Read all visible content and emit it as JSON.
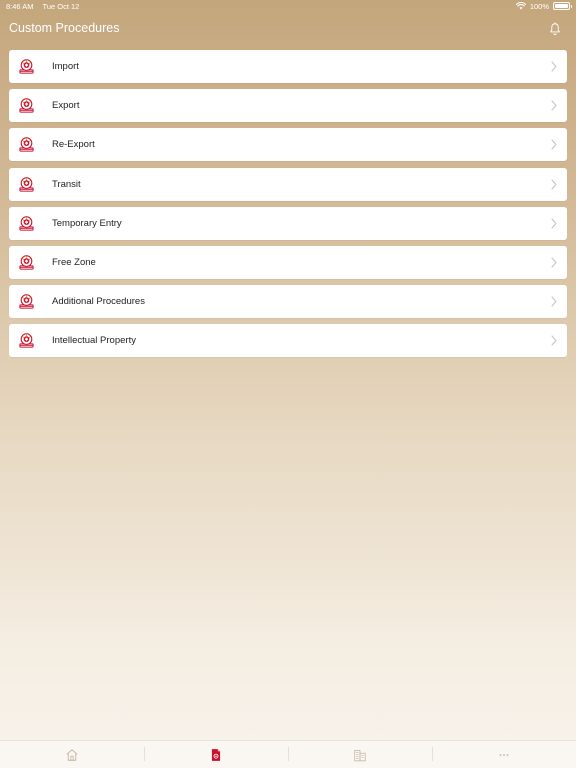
{
  "status_bar": {
    "time": "8:46 AM",
    "date": "Tue Oct 12",
    "battery": "100%"
  },
  "header": {
    "title": "Custom Procedures",
    "action_icon": "bell-icon"
  },
  "procedures": {
    "items": [
      {
        "label": "Import",
        "icon": "customs-logo-icon"
      },
      {
        "label": "Export",
        "icon": "customs-logo-icon"
      },
      {
        "label": "Re-Export",
        "icon": "customs-logo-icon"
      },
      {
        "label": "Transit",
        "icon": "customs-logo-icon"
      },
      {
        "label": "Temporary Entry",
        "icon": "customs-logo-icon"
      },
      {
        "label": "Free Zone",
        "icon": "customs-logo-icon"
      },
      {
        "label": "Additional Procedures",
        "icon": "customs-logo-icon"
      },
      {
        "label": "Intellectual Property",
        "icon": "customs-logo-icon"
      }
    ]
  },
  "tab_bar": {
    "tabs": [
      {
        "icon": "home-icon",
        "active": false
      },
      {
        "icon": "procedures-document-icon",
        "active": true
      },
      {
        "icon": "buildings-icon",
        "active": false
      },
      {
        "icon": "more-icon",
        "active": false
      }
    ]
  },
  "colors": {
    "accent": "#c8102e",
    "inactive_icon": "#c2b6a6"
  }
}
